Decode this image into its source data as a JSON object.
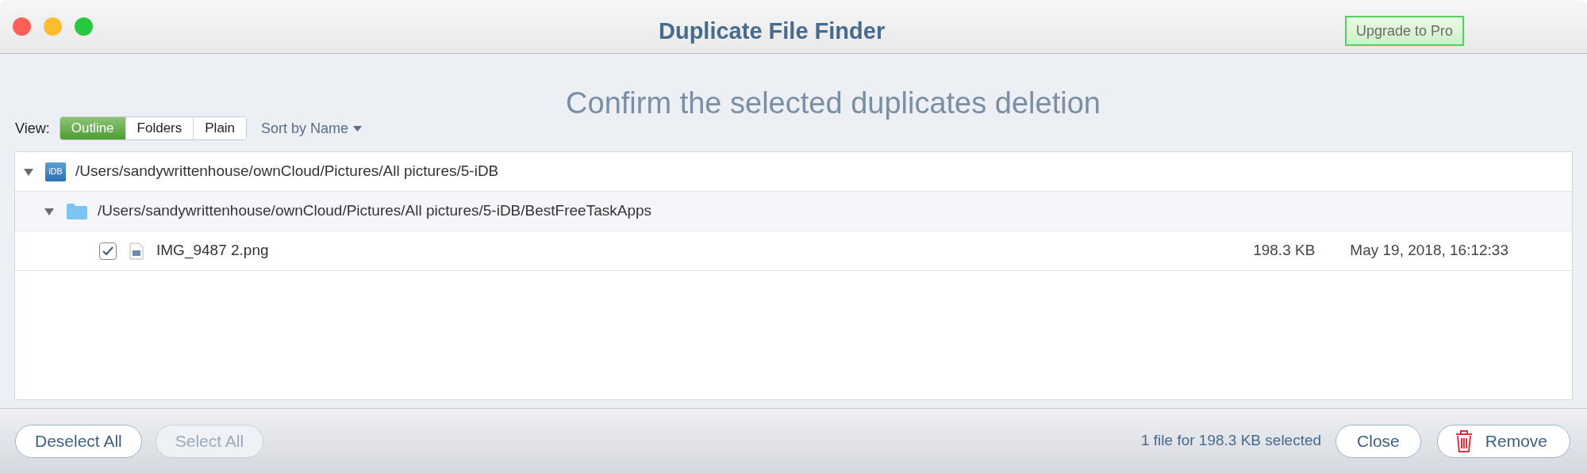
{
  "window": {
    "title": "Duplicate File Finder"
  },
  "upgrade_button": "Upgrade to Pro",
  "heading": "Confirm the selected duplicates deletion",
  "view": {
    "label": "View:",
    "options": [
      {
        "label": "Outline",
        "selected": true
      },
      {
        "label": "Folders",
        "selected": false
      },
      {
        "label": "Plain",
        "selected": false
      }
    ],
    "sort": "Sort by Name"
  },
  "tree": [
    {
      "kind": "volume",
      "path": "/Users/sandywrittenhouse/ownCloud/Pictures/All pictures/5-iDB",
      "icon_text": "iDB",
      "expanded": true,
      "children": [
        {
          "kind": "folder",
          "path": "/Users/sandywrittenhouse/ownCloud/Pictures/All pictures/5-iDB/BestFreeTaskApps",
          "expanded": true,
          "children": [
            {
              "kind": "file",
              "name": "IMG_9487 2.png",
              "checked": true,
              "size": "198.3 KB",
              "date": "May 19, 2018, 16:12:33"
            }
          ]
        }
      ]
    }
  ],
  "footer": {
    "deselect_all": {
      "label": "Deselect All",
      "disabled": false
    },
    "select_all": {
      "label": "Select All",
      "disabled": true
    },
    "summary": "1 file for 198.3 KB selected",
    "close": "Close",
    "remove": "Remove"
  }
}
